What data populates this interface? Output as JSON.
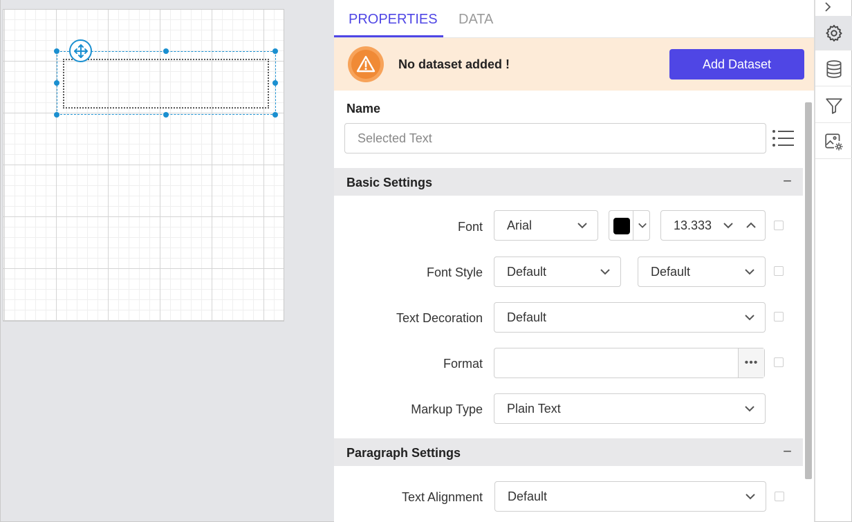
{
  "tabs": {
    "properties": "PROPERTIES",
    "data": "DATA"
  },
  "alert": {
    "message": "No dataset added !",
    "button": "Add Dataset"
  },
  "name": {
    "label": "Name",
    "placeholder": "Selected Text"
  },
  "basic_settings": {
    "title": "Basic Settings",
    "font_label": "Font",
    "font_family": "Arial",
    "font_size": "13.333",
    "font_color": "#000000",
    "font_style_label": "Font Style",
    "font_style_value": "Default",
    "font_weight_value": "Default",
    "text_decoration_label": "Text Decoration",
    "text_decoration_value": "Default",
    "format_label": "Format",
    "format_value": "",
    "markup_type_label": "Markup Type",
    "markup_type_value": "Plain Text"
  },
  "paragraph_settings": {
    "title": "Paragraph Settings",
    "text_alignment_label": "Text Alignment",
    "text_alignment_value": "Default"
  },
  "rail": {
    "items": [
      "gear-icon",
      "database-icon",
      "filter-icon",
      "image-settings-icon"
    ]
  },
  "colors": {
    "accent": "#4f46e5",
    "alert_bg": "#fdebd8",
    "warning": "#f08a36",
    "selection": "#1a8fd0"
  }
}
